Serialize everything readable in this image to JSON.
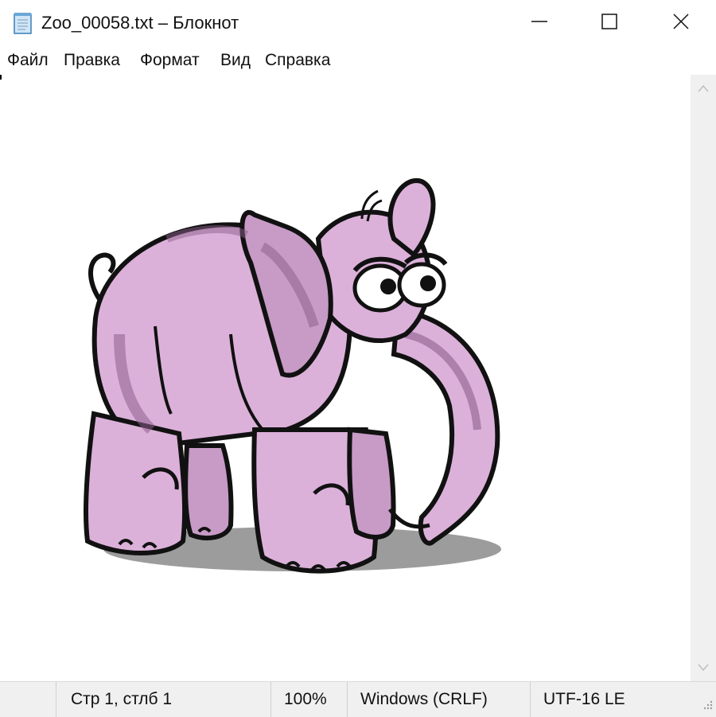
{
  "window": {
    "title": "Zoo_00058.txt – Блокнот",
    "icon": "notepad-icon"
  },
  "controls": {
    "minimize_icon": "minimize-icon",
    "maximize_icon": "maximize-icon",
    "close_icon": "close-icon"
  },
  "menu": {
    "items": [
      "Файл",
      "Правка",
      "Формат",
      "Вид",
      "Справка"
    ]
  },
  "editor": {
    "content_picture": "pink-elephant-ascii-art"
  },
  "status": {
    "position": "Стр 1, стлб 1",
    "zoom": "100%",
    "line_endings": "Windows (CRLF)",
    "encoding": "UTF-16 LE"
  },
  "colors": {
    "elephant_fill": "#dbb1d9",
    "elephant_shade": "#8e5f8c",
    "outline": "#111111",
    "shadow": "#9c9c9c",
    "status_bg": "#f0f0f0"
  }
}
